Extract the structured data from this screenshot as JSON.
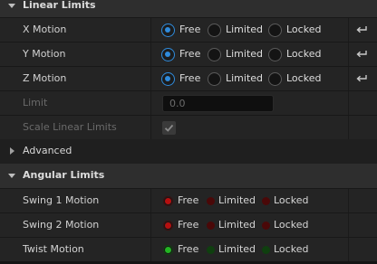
{
  "linear_limits": {
    "title": "Linear Limits",
    "x_motion": {
      "label": "X Motion",
      "options": [
        "Free",
        "Limited",
        "Locked"
      ],
      "selected": "Free"
    },
    "y_motion": {
      "label": "Y Motion",
      "options": [
        "Free",
        "Limited",
        "Locked"
      ],
      "selected": "Free"
    },
    "z_motion": {
      "label": "Z Motion",
      "options": [
        "Free",
        "Limited",
        "Locked"
      ],
      "selected": "Free"
    },
    "limit": {
      "label": "Limit",
      "value": "0.0"
    },
    "scale_linear_limits": {
      "label": "Scale Linear Limits",
      "checked": true
    }
  },
  "advanced": {
    "title": "Advanced"
  },
  "angular_limits": {
    "title": "Angular Limits",
    "swing1": {
      "label": "Swing 1 Motion",
      "options": [
        "Free",
        "Limited",
        "Locked"
      ],
      "selected": "Free"
    },
    "swing2": {
      "label": "Swing 2 Motion",
      "options": [
        "Free",
        "Limited",
        "Locked"
      ],
      "selected": "Free"
    },
    "twist": {
      "label": "Twist Motion",
      "options": [
        "Free",
        "Limited",
        "Locked"
      ],
      "selected": "Free"
    }
  },
  "colors": {
    "accent_blue": "#2f8bdc",
    "swing_red": "#b60f0f",
    "twist_green": "#22b522"
  },
  "icons": {
    "reset": "reset-arrow-icon",
    "collapse": "chevron-down-icon",
    "expand": "chevron-right-icon",
    "check": "check-icon"
  }
}
